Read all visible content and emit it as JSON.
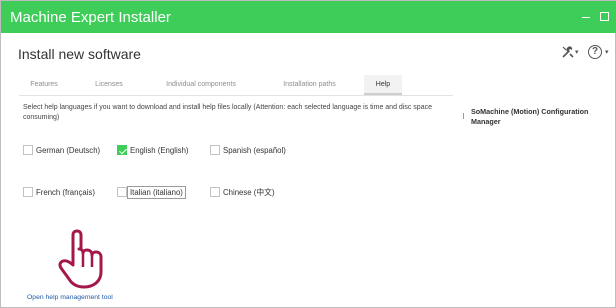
{
  "window": {
    "title": "Machine Expert Installer",
    "minimize_glyph": "",
    "maximize_glyph": "",
    "accent_color": "#3dcd58"
  },
  "header": {
    "title": "Install new software",
    "tools_icon": "tools-icon",
    "help_icon_glyph": "?",
    "caret_glyph": "▾"
  },
  "tabs": [
    {
      "label": "Features",
      "active": false
    },
    {
      "label": "Licenses",
      "active": false
    },
    {
      "label": "Individual components",
      "active": false
    },
    {
      "label": "Installation paths",
      "active": false
    },
    {
      "label": "Help",
      "active": true
    }
  ],
  "help": {
    "description": "Select help languages if you want to download and install help files locally (Attention: each selected language is time and disc space consuming)",
    "languages": [
      {
        "label": "German (Deutsch)",
        "checked": false
      },
      {
        "label": "English (English)",
        "checked": true
      },
      {
        "label": "Spanish (español)",
        "checked": false
      },
      {
        "label": "French (français)",
        "checked": false
      },
      {
        "label": "Italian (italiano)",
        "checked": false,
        "focused": true
      },
      {
        "label": "Chinese (中文)",
        "checked": false
      }
    ],
    "link_label": "Open help management tool"
  },
  "side_panel": {
    "title": "SoMachine (Motion) Configuration Manager"
  },
  "annotation": {
    "pointer_icon": "hand-pointer-icon",
    "pointer_color": "#a3174b"
  }
}
